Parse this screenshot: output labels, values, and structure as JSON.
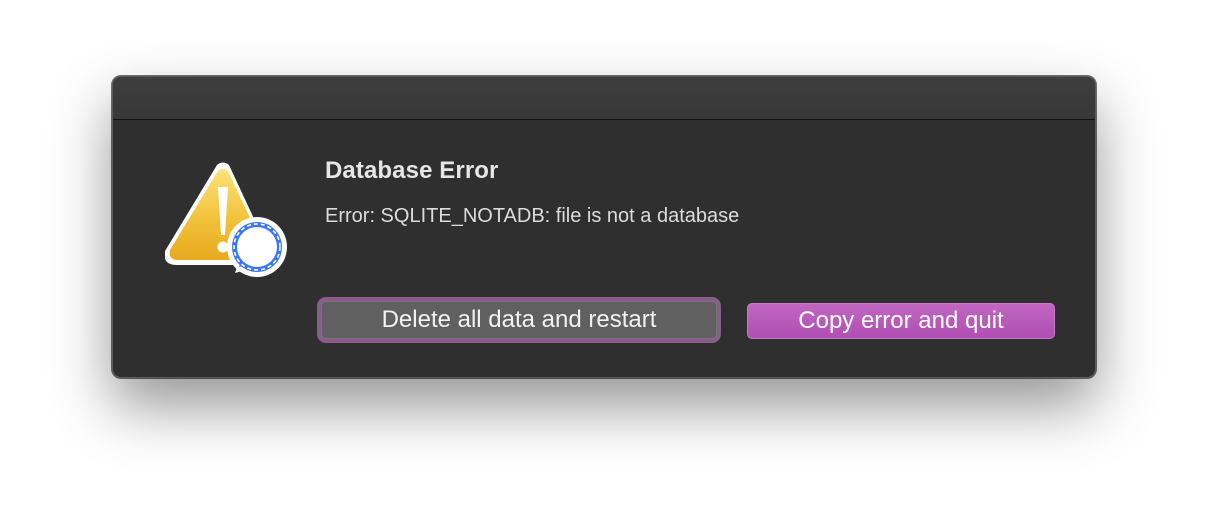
{
  "dialog": {
    "title": "Database Error",
    "message": "Error: SQLITE_NOTADB: file is not a database",
    "icon": "warning-triangle-with-signal-badge-icon"
  },
  "buttons": {
    "secondary_label": "Delete all data and restart",
    "primary_label": "Copy error and quit"
  },
  "colors": {
    "window_background": "#2f2f2f",
    "titlebar_background": "#3b3b3b",
    "primary_button": "#b552b7",
    "secondary_button": "#606060",
    "focus_ring": "#8a5c8e",
    "warning_yellow": "#f2c438",
    "signal_blue": "#3a76f0"
  }
}
